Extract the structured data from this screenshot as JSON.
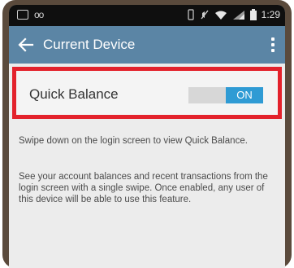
{
  "status_bar": {
    "time": "1:29",
    "left_icons": [
      "photo-icon",
      "voicemail-icon"
    ],
    "right_icons": [
      "vibrate-icon",
      "mute-icon",
      "wifi-icon",
      "signal-icon",
      "battery-icon"
    ]
  },
  "app_bar": {
    "title": "Current Device",
    "back_icon": "arrow-left",
    "menu_icon": "more-vertical"
  },
  "setting": {
    "label": "Quick Balance",
    "toggle_state": "ON"
  },
  "descriptions": [
    "Swipe down on the login screen to view Quick Balance.",
    "See your account balances and recent transactions from the login screen with a single swipe. Once enabled, any user of this device will be able to use this feature."
  ],
  "colors": {
    "frame": "#5a4a3c",
    "app_bar": "#5b85a5",
    "toggle_on": "#2f9bd4",
    "highlight_border": "#e3222c",
    "screen_bg": "#ececec"
  }
}
